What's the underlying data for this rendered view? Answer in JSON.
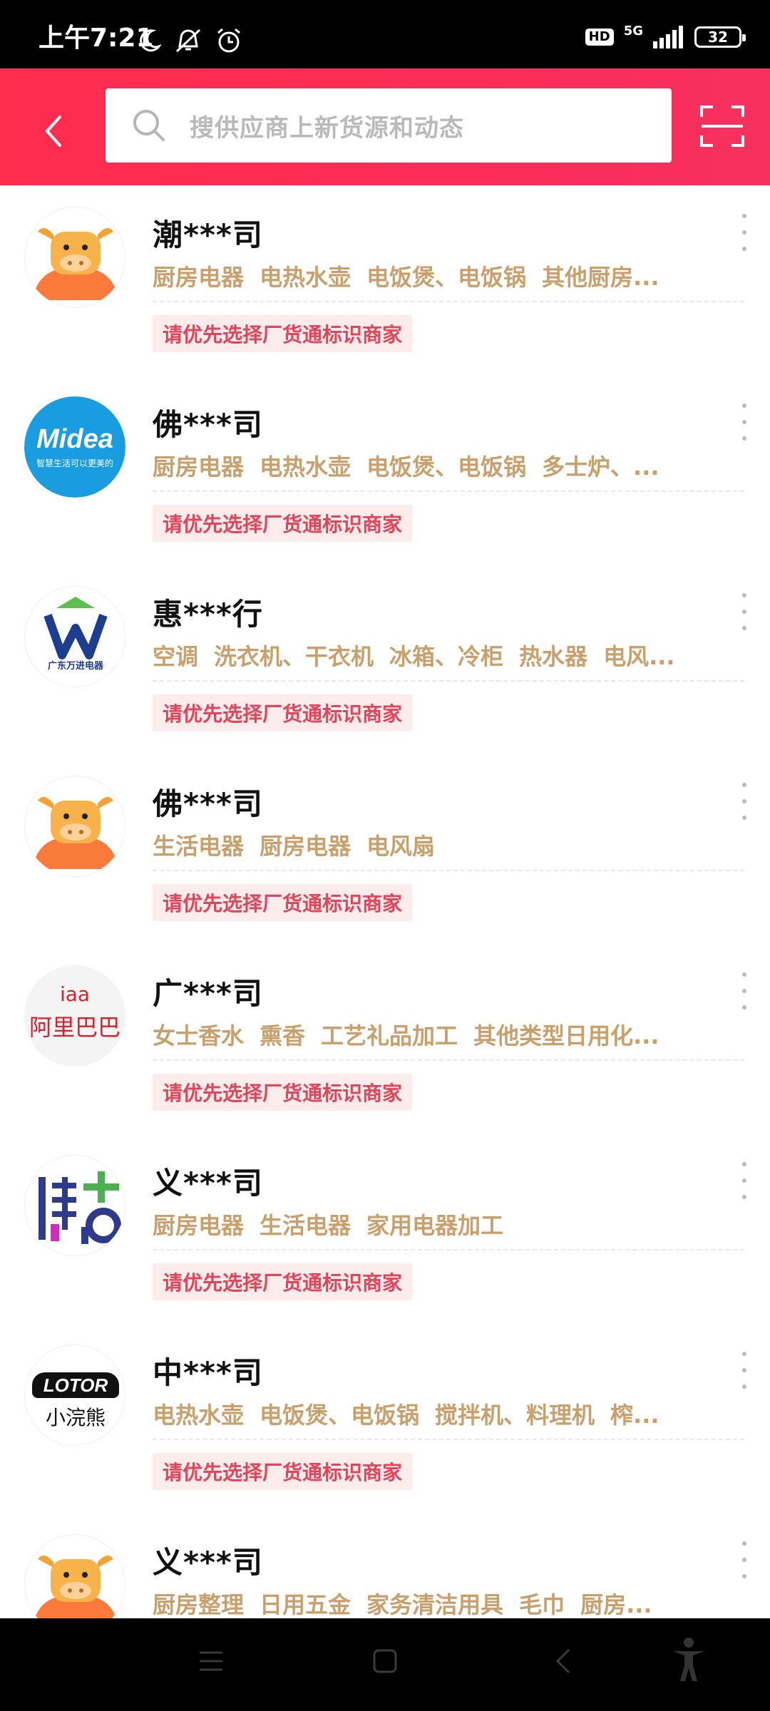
{
  "status_bar": {
    "time": "上午7:21",
    "hd": "HD",
    "network": "5G",
    "battery": "32"
  },
  "header": {
    "search_placeholder": "搜供应商上新货源和动态"
  },
  "companies": [
    {
      "name": "潮***司",
      "avatar": "cow-avatar",
      "categories": [
        "厨房电器",
        "电热水壶",
        "电饭煲、电饭锅",
        "其他厨房..."
      ],
      "tag": "请优先选择厂货通标识商家"
    },
    {
      "name": "佛***司",
      "avatar": "midea-logo",
      "avatar_text": "Midea",
      "avatar_sub": "智慧生活可以更美的",
      "categories": [
        "厨房电器",
        "电热水壶",
        "电饭煲、电饭锅",
        "多士炉、..."
      ],
      "tag": "请优先选择厂货通标识商家"
    },
    {
      "name": "惠***行",
      "avatar": "wanjin-logo",
      "avatar_text": "广东万进电器",
      "categories": [
        "空调",
        "洗衣机、干衣机",
        "冰箱、冷柜",
        "热水器",
        "电风..."
      ],
      "tag": "请优先选择厂货通标识商家"
    },
    {
      "name": "佛***司",
      "avatar": "cow-avatar",
      "categories": [
        "生活电器",
        "厨房电器",
        "电风扇"
      ],
      "tag": "请优先选择厂货通标识商家"
    },
    {
      "name": "广***司",
      "avatar": "alibaba-logo",
      "avatar_text": "iaa",
      "avatar_sub": "阿里巴巴",
      "categories": [
        "女士香水",
        "熏香",
        "工艺礼品加工",
        "其他类型日用化..."
      ],
      "tag": "请优先选择厂货通标识商家"
    },
    {
      "name": "义***司",
      "avatar": "bogu-logo",
      "categories": [
        "厨房电器",
        "生活电器",
        "家用电器加工"
      ],
      "tag": "请优先选择厂货通标识商家"
    },
    {
      "name": "中***司",
      "avatar": "lotor-logo",
      "avatar_text": "LOTOR",
      "avatar_sub": "小浣熊",
      "categories": [
        "电热水壶",
        "电饭煲、电饭锅",
        "搅拌机、料理机",
        "榨..."
      ],
      "tag": "请优先选择厂货通标识商家"
    },
    {
      "name": "义***司",
      "avatar": "cow-avatar",
      "categories": [
        "厨房整理",
        "日用五金",
        "家务清洁用具",
        "毛巾",
        "厨房..."
      ],
      "tag": ""
    }
  ],
  "colors": {
    "header_red": "#fe2c4d",
    "category_gold": "#c9a06c",
    "tag_text": "#e0455a",
    "tag_bg": "#fdecec"
  }
}
